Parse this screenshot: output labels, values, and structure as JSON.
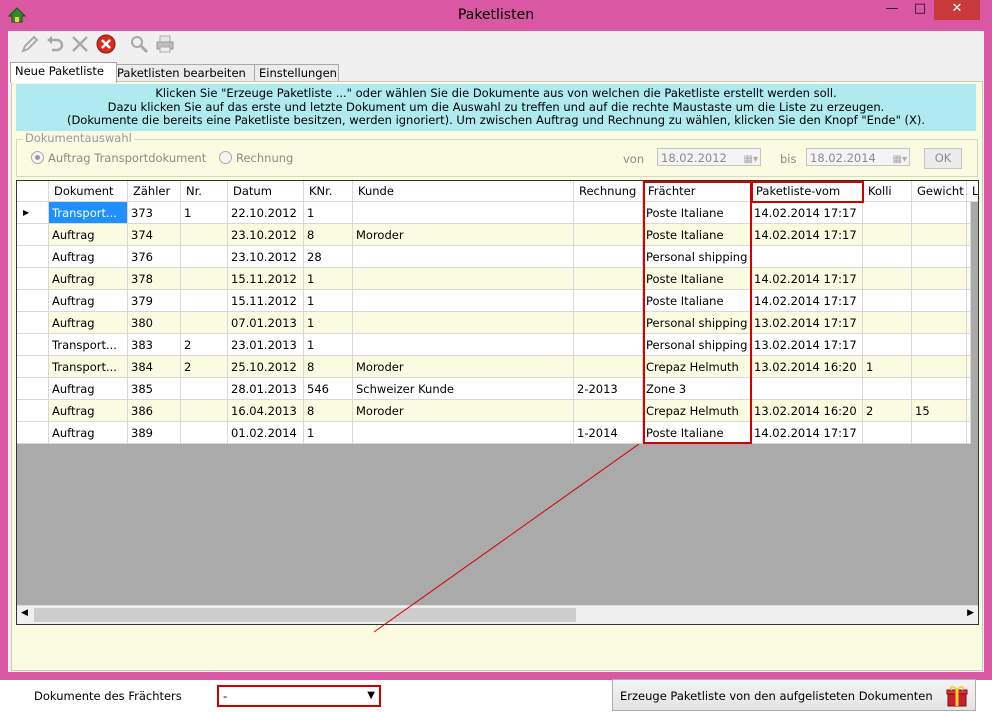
{
  "window": {
    "title": "Paketlisten"
  },
  "toolbar": {
    "icons": [
      "pencil-icon",
      "undo-icon",
      "cut-icon",
      "cancel-icon",
      "search-icon",
      "print-icon"
    ]
  },
  "tabs": [
    {
      "label": "Neue Paketliste",
      "active": true
    },
    {
      "label": "Paketlisten bearbeiten",
      "active": false
    },
    {
      "label": "Einstellungen",
      "active": false
    }
  ],
  "info": {
    "line1": "Klicken Sie \"Erzeuge Paketliste ...\" oder wählen Sie die Dokumente aus von welchen die Paketliste erstellt werden soll.",
    "line2": "Dazu klicken Sie auf das erste und letzte Dokument um die Auswahl zu treffen und auf die rechte Maustaste um die Liste zu erzeugen.",
    "line3": "(Dokumente die bereits eine Paketliste besitzen, werden ignoriert). Um zwischen Auftrag und Rechnung zu wählen, klicken Sie den Knopf \"Ende\" (X)."
  },
  "document_selection": {
    "group_label": "Dokumentauswahl",
    "option_order": "Auftrag Transportdokument",
    "option_invoice": "Rechnung",
    "from_label": "von",
    "from_date": "18.02.2012",
    "to_label": "bis",
    "to_date": "18.02.2014",
    "ok_label": "OK"
  },
  "grid": {
    "columns": [
      "Dokument",
      "Zähler",
      "Nr.",
      "Datum",
      "KNr.",
      "Kunde",
      "Rechnung",
      "Frächter",
      "Paketliste-vom",
      "Kolli",
      "Gewicht",
      "L"
    ],
    "rows": [
      [
        "Transport...",
        "373",
        "1",
        "22.10.2012",
        "1",
        "",
        "",
        "Poste Italiane",
        "14.02.2014 17:17",
        "",
        "",
        ""
      ],
      [
        "Auftrag",
        "374",
        "",
        "23.10.2012",
        "8",
        "Moroder",
        "",
        "Poste Italiane",
        "14.02.2014 17:17",
        "",
        "",
        ""
      ],
      [
        "Auftrag",
        "376",
        "",
        "23.10.2012",
        "28",
        "",
        "",
        "Personal shipping",
        "",
        "",
        "",
        ""
      ],
      [
        "Auftrag",
        "378",
        "",
        "15.11.2012",
        "1",
        "",
        "",
        "Poste Italiane",
        "14.02.2014 17:17",
        "",
        "",
        ""
      ],
      [
        "Auftrag",
        "379",
        "",
        "15.11.2012",
        "1",
        "",
        "",
        "Poste Italiane",
        "14.02.2014 17:17",
        "",
        "",
        ""
      ],
      [
        "Auftrag",
        "380",
        "",
        "07.01.2013",
        "1",
        "",
        "",
        "Personal shipping",
        "13.02.2014 17:17",
        "",
        "",
        ""
      ],
      [
        "Transport...",
        "383",
        "2",
        "23.01.2013",
        "1",
        "",
        "",
        "Personal shipping",
        "13.02.2014 17:17",
        "",
        "",
        ""
      ],
      [
        "Transport...",
        "384",
        "2",
        "25.10.2012",
        "8",
        "Moroder",
        "",
        "Crepaz Helmuth",
        "13.02.2014 16:20",
        "1",
        "",
        ""
      ],
      [
        "Auftrag",
        "385",
        "",
        "28.01.2013",
        "546",
        "Schweizer Kunde",
        "2-2013",
        "Zone 3",
        "",
        "",
        "",
        ""
      ],
      [
        "Auftrag",
        "386",
        "",
        "16.04.2013",
        "8",
        "Moroder",
        "",
        "Crepaz Helmuth",
        "13.02.2014 16:20",
        "2",
        "15",
        ""
      ],
      [
        "Auftrag",
        "389",
        "",
        "01.02.2014",
        "1",
        "",
        "1-2014",
        "Poste Italiane",
        "14.02.2014 17:17",
        "",
        "",
        ""
      ]
    ],
    "selected_row": 0
  },
  "bottom": {
    "carrier_label": "Dokumente des Frächters",
    "carrier_value": "-",
    "generate_label": "Erzeuge Paketliste von den aufgelisteten Dokumenten"
  },
  "colors": {
    "window_frame": "#d957a3",
    "panel_bg": "#fbfbe2",
    "info_bg": "#aeeaf0",
    "selected_cell": "#1e90ff",
    "highlight": "#d40000"
  }
}
